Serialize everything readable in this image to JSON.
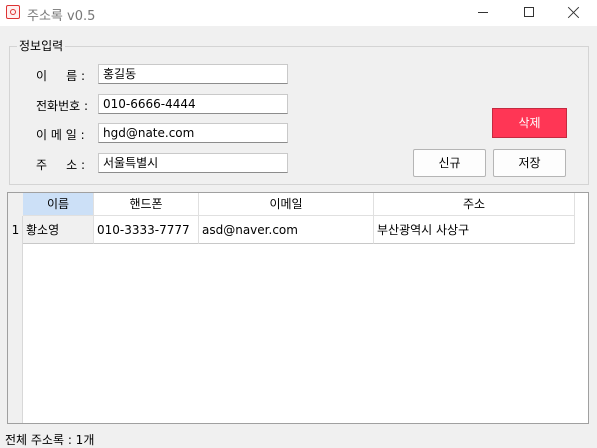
{
  "window": {
    "title": "주소록 v0.5",
    "controls": {
      "minimize": "minimize",
      "maximize": "maximize",
      "close": "close"
    }
  },
  "info_group": {
    "title": "정보입력",
    "fields": {
      "name": {
        "label": "이     름 :",
        "value": "홍길동"
      },
      "phone": {
        "label": "전화번호 :",
        "value": "010-6666-4444"
      },
      "email": {
        "label": "이 메 일 :",
        "value": "hgd@nate.com"
      },
      "address": {
        "label": "주     소 :",
        "value": "서울특별시"
      }
    },
    "buttons": {
      "delete": "삭제",
      "new": "신규",
      "save": "저장"
    },
    "delete_color": "#ff3655"
  },
  "grid": {
    "columns": [
      "이름",
      "핸드폰",
      "이메일",
      "주소"
    ],
    "selected_column": "이름",
    "rows": [
      {
        "num": "1",
        "name": "황소영",
        "phone": "010-3333-7777",
        "email": "asd@naver.com",
        "address": "부산광역시 사상구"
      }
    ]
  },
  "status": {
    "text": "전체 주소록 : 1개"
  }
}
